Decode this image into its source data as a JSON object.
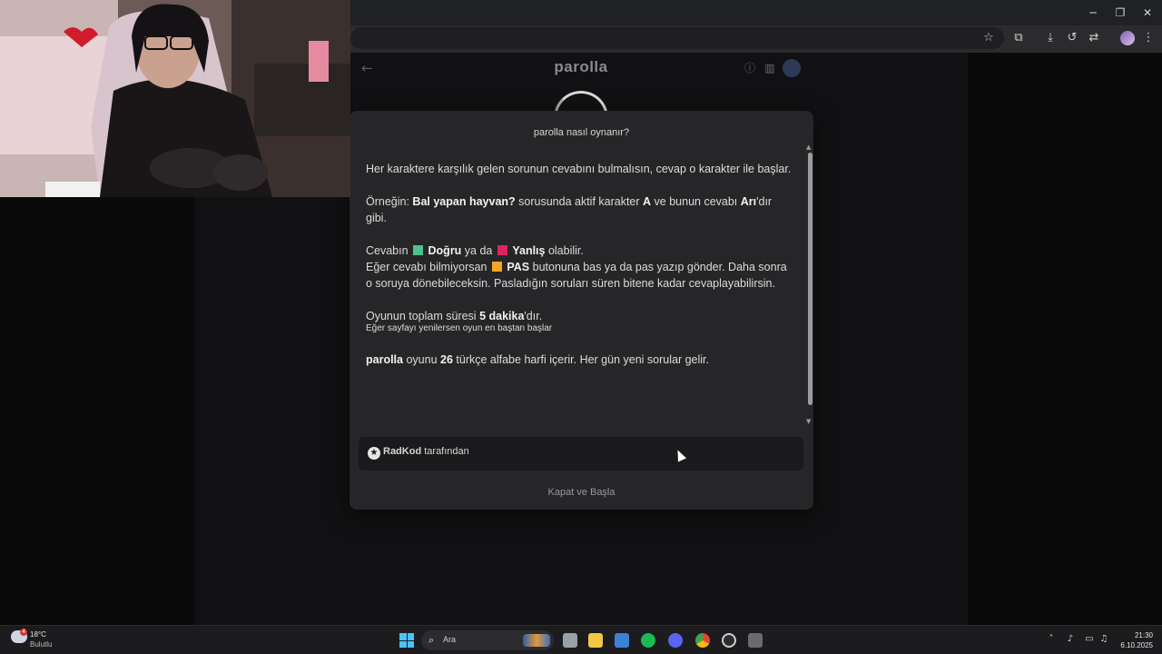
{
  "window": {
    "minimize": "─",
    "restore": "❐",
    "close": "✕"
  },
  "site": {
    "title": "parolla",
    "back_glyph": "←",
    "info_glyph": "ⓘ",
    "stats_glyph": "▥"
  },
  "modal": {
    "title": "parolla nasıl oynanır?",
    "p1": "Her karaktere karşılık gelen sorunun cevabını bulmalısın, cevap o karakter ile başlar.",
    "p2": {
      "a": "Örneğin: ",
      "b": "Bal yapan hayvan?",
      "c": " sorusunda aktif karakter ",
      "d": "A",
      "e": " ve bunun cevabı ",
      "f": "Arı",
      "g": "'dır gibi."
    },
    "p3": {
      "a": "Cevabın ",
      "correct": "Doğru",
      "b": " ya da ",
      "wrong": "Yanlış",
      "c": " olabilir.",
      "d": "Eğer cevabı bilmiyorsan ",
      "pass": "PAS",
      "e": " butonuna bas ya da pas yazıp gönder. Daha sonra o soruya dönebileceksin. Pasladığın soruları süren bitene kadar cevaplayabilirsin."
    },
    "p4": {
      "a": "Oyunun toplam süresi ",
      "b": "5 dakika",
      "c": "'dır."
    },
    "p4_small": "Eğer sayfayı yenilersen oyun en baştan başlar",
    "p5": {
      "a": "parolla",
      "b": " oyunu ",
      "c": "26",
      "d": " türkçe alfabe harfi içerir. Her gün yeni sorular gelir."
    },
    "credit_icon": "★",
    "credit_name": "RadKod",
    "credit_suffix": " tarafından",
    "close_label": "Kapat ve Başla",
    "colors": {
      "correct": "#4cc38a",
      "wrong": "#e0245e",
      "pass": "#f5a623"
    }
  },
  "taskbar": {
    "temperature": "18°C",
    "condition": "Bulutlu",
    "weather_badge": "4",
    "search_label": "Ara",
    "search_glyph": "⌕",
    "time": "21:30",
    "date": "6.10.2025"
  }
}
